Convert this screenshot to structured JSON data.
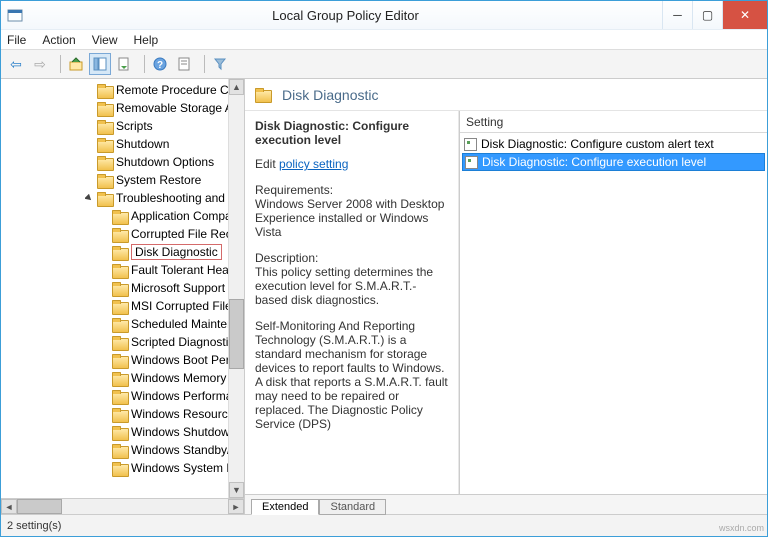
{
  "window": {
    "title": "Local Group Policy Editor"
  },
  "menu": {
    "file": "File",
    "action": "Action",
    "view": "View",
    "help": "Help"
  },
  "tree": {
    "items": [
      {
        "indent": 84,
        "label": "Remote Procedure Cal"
      },
      {
        "indent": 84,
        "label": "Removable Storage Ac"
      },
      {
        "indent": 84,
        "label": "Scripts"
      },
      {
        "indent": 84,
        "label": "Shutdown"
      },
      {
        "indent": 84,
        "label": "Shutdown Options"
      },
      {
        "indent": 84,
        "label": "System Restore"
      },
      {
        "indent": 84,
        "label": "Troubleshooting and D",
        "expander": "open"
      },
      {
        "indent": 99,
        "label": "Application Compa"
      },
      {
        "indent": 99,
        "label": "Corrupted File Reco"
      },
      {
        "indent": 99,
        "label": "Disk Diagnostic",
        "selected": true
      },
      {
        "indent": 99,
        "label": "Fault Tolerant Heap"
      },
      {
        "indent": 99,
        "label": "Microsoft Support"
      },
      {
        "indent": 99,
        "label": "MSI Corrupted File"
      },
      {
        "indent": 99,
        "label": "Scheduled Mainten"
      },
      {
        "indent": 99,
        "label": "Scripted Diagnostic"
      },
      {
        "indent": 99,
        "label": "Windows Boot Perf"
      },
      {
        "indent": 99,
        "label": "Windows Memory"
      },
      {
        "indent": 99,
        "label": "Windows Performa"
      },
      {
        "indent": 99,
        "label": "Windows Resource"
      },
      {
        "indent": 99,
        "label": "Windows Shutdown"
      },
      {
        "indent": 99,
        "label": "Windows Standby/"
      },
      {
        "indent": 99,
        "label": "Windows System R"
      }
    ]
  },
  "right": {
    "header": "Disk Diagnostic",
    "desc": {
      "title": "Disk Diagnostic: Configure execution level",
      "edit": "Edit",
      "link": "policy setting",
      "req_h": "Requirements:",
      "req_b": "Windows Server 2008 with Desktop Experience installed or Windows Vista",
      "desc_h": "Description:",
      "desc_b1": "This policy setting determines the execution level for S.M.A.R.T.-based disk diagnostics.",
      "desc_b2": "Self-Monitoring And Reporting Technology (S.M.A.R.T.) is a standard mechanism for storage devices to report faults to Windows. A disk that reports a S.M.A.R.T. fault may need to be repaired or replaced. The Diagnostic Policy Service (DPS)"
    },
    "list": {
      "header": "Setting",
      "items": [
        {
          "label": "Disk Diagnostic: Configure custom alert text"
        },
        {
          "label": "Disk Diagnostic: Configure execution level",
          "selected": true
        }
      ]
    },
    "tabs": {
      "extended": "Extended",
      "standard": "Standard"
    }
  },
  "status": {
    "text": "2 setting(s)"
  }
}
